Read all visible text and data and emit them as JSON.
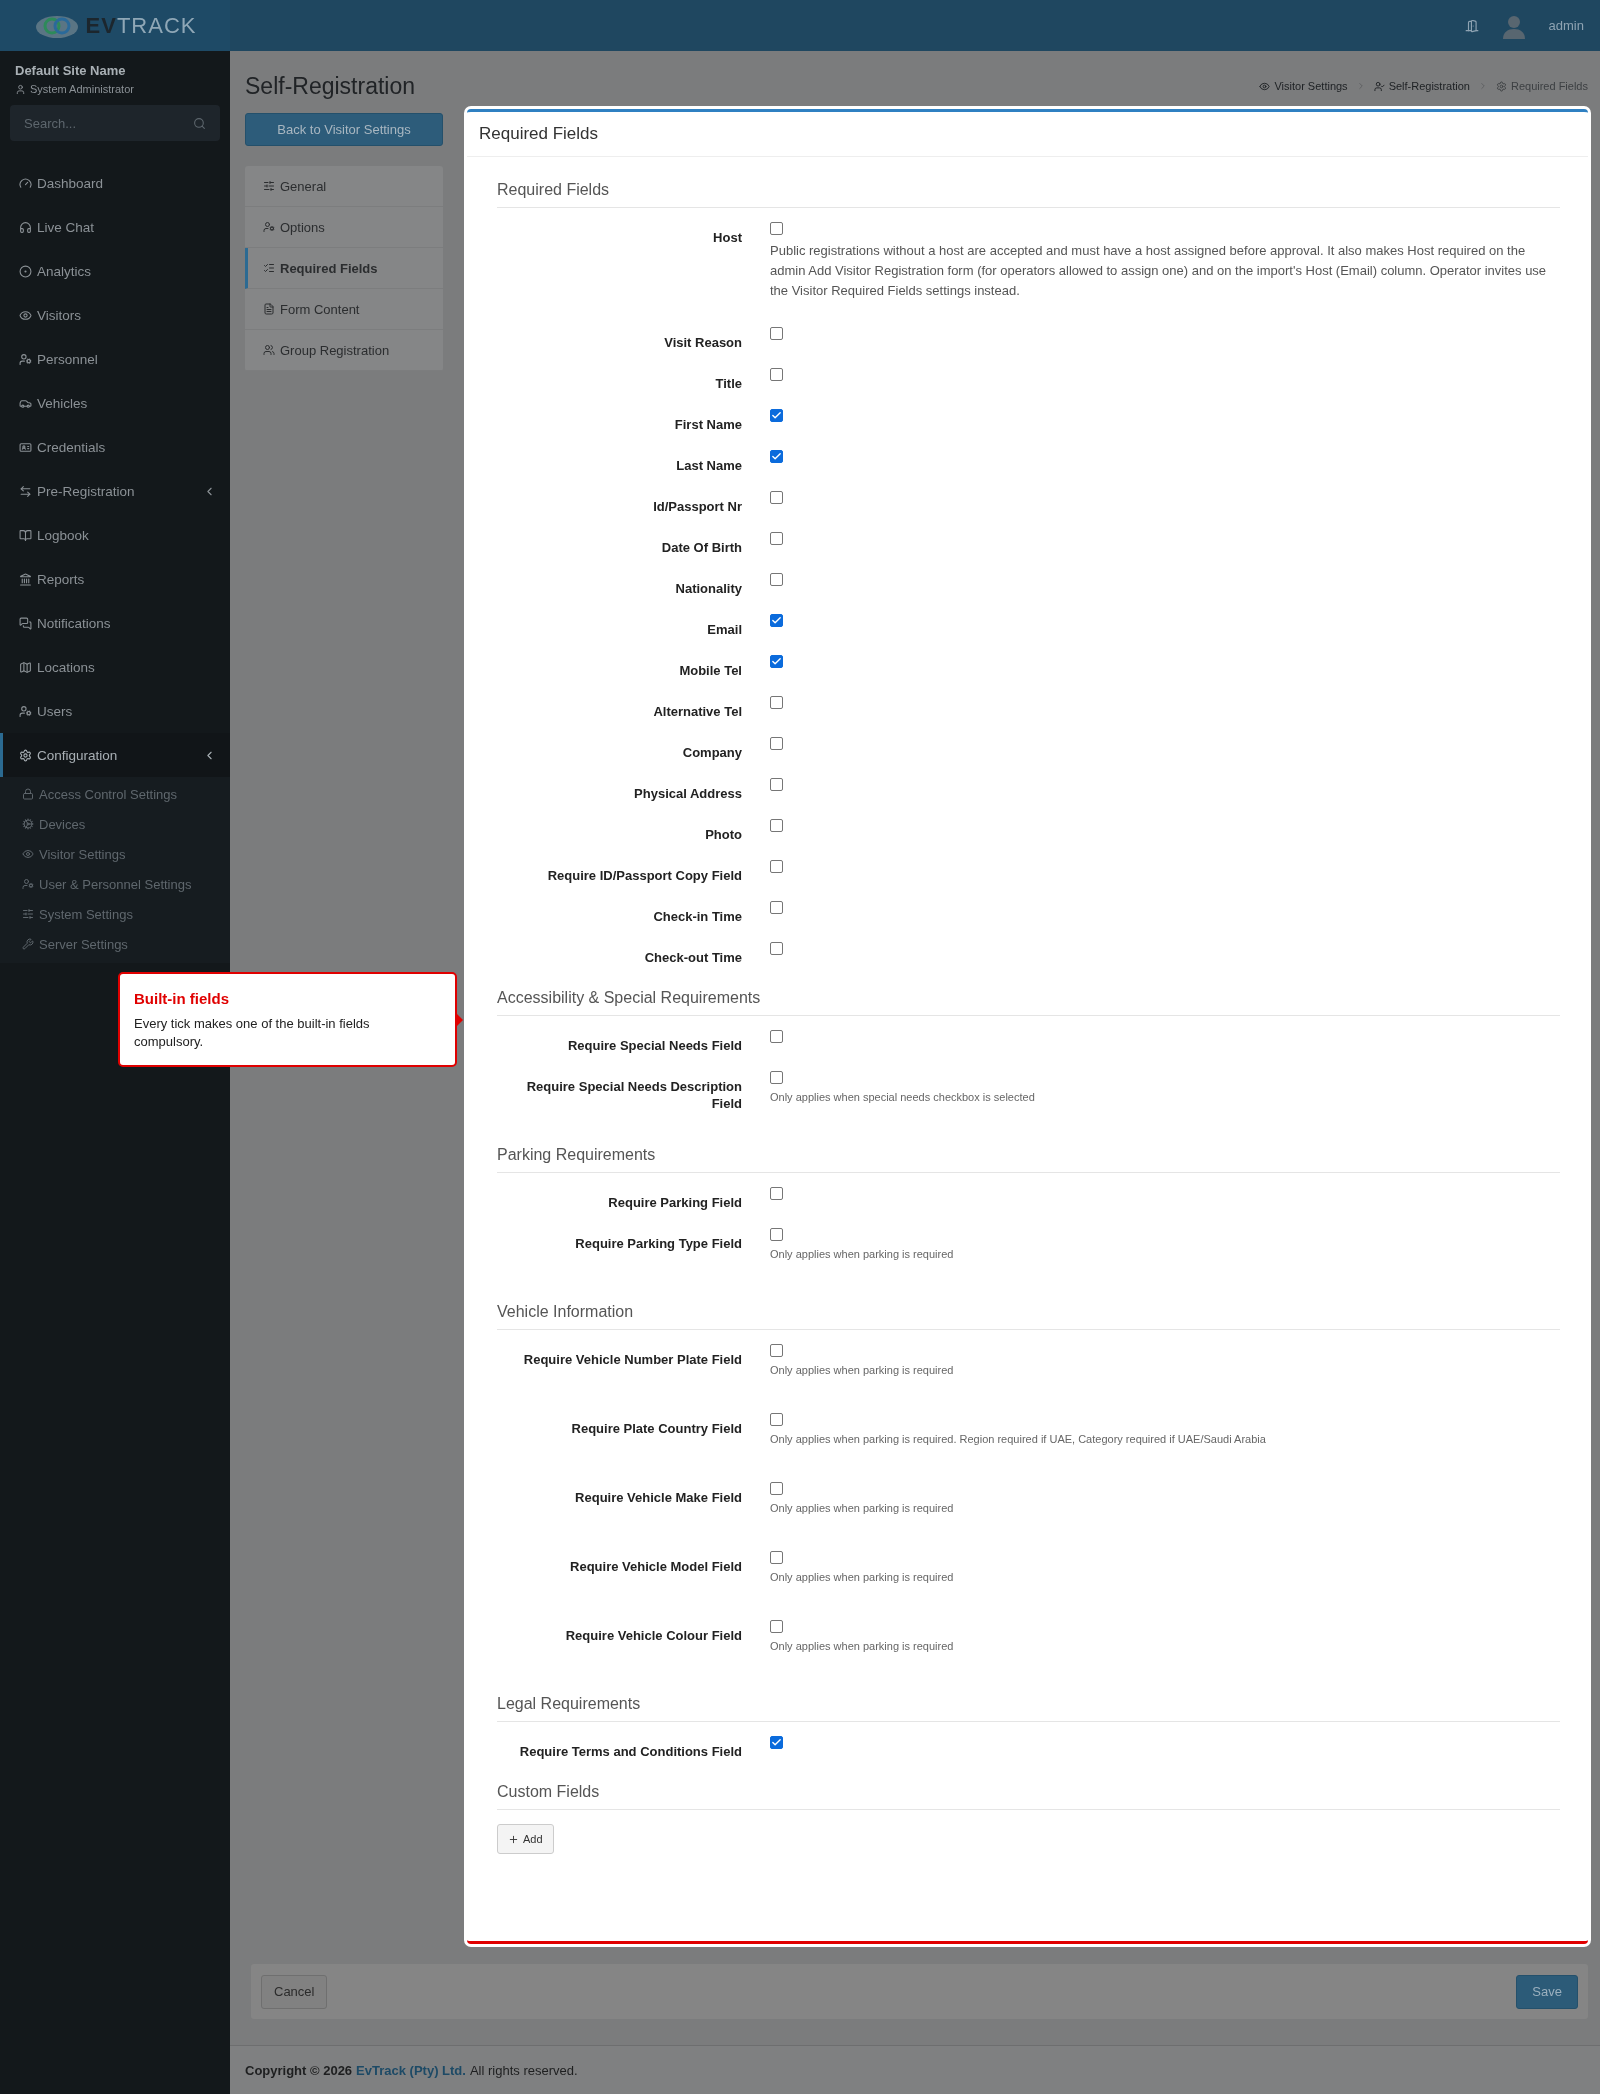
{
  "brand": {
    "logo": "**EV**TRACK"
  },
  "topbar": {
    "user": "admin"
  },
  "sidebar": {
    "site_name": "Default Site Name",
    "role": "System Administrator",
    "search": {
      "placeholder": "Search..."
    },
    "items": [
      {
        "label": "Dashboard",
        "expandable": false,
        "selected": false
      },
      {
        "label": "Live Chat",
        "expandable": false,
        "selected": false
      },
      {
        "label": "Analytics",
        "expandable": false,
        "selected": false
      },
      {
        "label": "Visitors",
        "expandable": false,
        "selected": false
      },
      {
        "label": "Personnel",
        "expandable": false,
        "selected": false
      },
      {
        "label": "Vehicles",
        "expandable": false,
        "selected": false
      },
      {
        "label": "Credentials",
        "expandable": false,
        "selected": false
      },
      {
        "label": "Pre-Registration",
        "expandable": true,
        "selected": false
      },
      {
        "label": "Logbook",
        "expandable": false,
        "selected": false
      },
      {
        "label": "Reports",
        "expandable": false,
        "selected": false
      },
      {
        "label": "Notifications",
        "expandable": false,
        "selected": false
      },
      {
        "label": "Locations",
        "expandable": false,
        "selected": false
      },
      {
        "label": "Users",
        "expandable": false,
        "selected": false
      },
      {
        "label": "Configuration",
        "expandable": true,
        "selected": true,
        "children": [
          {
            "label": "Access Control Settings"
          },
          {
            "label": "Devices"
          },
          {
            "label": "Visitor Settings"
          },
          {
            "label": "User & Personnel Settings"
          },
          {
            "label": "System Settings"
          },
          {
            "label": "Server Settings"
          }
        ]
      }
    ]
  },
  "page_title": "Self-Registration",
  "breadcrumbs": [
    {
      "label": "Visitor Settings",
      "current": false
    },
    {
      "label": "Self-Registration",
      "current": false
    },
    {
      "label": "Required Fields",
      "current": true
    }
  ],
  "back_button": "Back to Visitor Settings",
  "submenu": [
    {
      "label": "General",
      "selected": false
    },
    {
      "label": "Options",
      "selected": false
    },
    {
      "label": "Required Fields",
      "selected": true
    },
    {
      "label": "Form Content",
      "selected": false
    },
    {
      "label": "Group Registration",
      "selected": false
    }
  ],
  "card": {
    "title": "Required Fields",
    "sections": [
      {
        "title": "Required Fields",
        "fields": [
          {
            "label": "Host",
            "checked": false,
            "help": "Public registrations without a host are accepted and must have a host assigned before approval. It also makes Host required on the admin Add Visitor Registration form (for operators allowed to assign one) and on the import's Host (Email) column. Operator invites use the Visitor Required Fields settings instead."
          },
          {
            "label": "Visit Reason",
            "checked": false
          },
          {
            "label": "Title",
            "checked": false
          },
          {
            "label": "First Name",
            "checked": true
          },
          {
            "label": "Last Name",
            "checked": true
          },
          {
            "label": "Id/Passport Nr",
            "checked": false
          },
          {
            "label": "Date Of Birth",
            "checked": false
          },
          {
            "label": "Nationality",
            "checked": false
          },
          {
            "label": "Email",
            "checked": true
          },
          {
            "label": "Mobile Tel",
            "checked": true
          },
          {
            "label": "Alternative Tel",
            "checked": false
          },
          {
            "label": "Company",
            "checked": false
          },
          {
            "label": "Physical Address",
            "checked": false
          },
          {
            "label": "Photo",
            "checked": false
          },
          {
            "label": "Require ID/Passport Copy Field",
            "checked": false
          },
          {
            "label": "Check-in Time",
            "checked": false
          },
          {
            "label": "Check-out Time",
            "checked": false
          }
        ]
      },
      {
        "title": "Accessibility & Special Requirements",
        "fields": [
          {
            "label": "Require Special Needs Field",
            "checked": false
          },
          {
            "label": "Require Special Needs Description Field",
            "checked": false,
            "help": "Only applies when special needs checkbox is selected"
          }
        ]
      },
      {
        "title": "Parking Requirements",
        "fields": [
          {
            "label": "Require Parking Field",
            "checked": false
          },
          {
            "label": "Require Parking Type Field",
            "checked": false,
            "help": "Only applies when parking is required"
          }
        ]
      },
      {
        "title": "Vehicle Information",
        "fields": [
          {
            "label": "Require Vehicle Number Plate Field",
            "checked": false,
            "help": "Only applies when parking is required"
          },
          {
            "label": "Require Plate Country Field",
            "checked": false,
            "help": "Only applies when parking is required. Region required if UAE, Category required if UAE/Saudi Arabia"
          },
          {
            "label": "Require Vehicle Make Field",
            "checked": false,
            "help": "Only applies when parking is required"
          },
          {
            "label": "Require Vehicle Model Field",
            "checked": false,
            "help": "Only applies when parking is required"
          },
          {
            "label": "Require Vehicle Colour Field",
            "checked": false,
            "help": "Only applies when parking is required"
          }
        ]
      },
      {
        "title": "Legal Requirements",
        "fields": [
          {
            "label": "Require Terms and Conditions Field",
            "checked": true
          }
        ]
      },
      {
        "title": "Custom Fields"
      }
    ],
    "add_button": "Add"
  },
  "actions": {
    "cancel": "Cancel",
    "save": "Save"
  },
  "footer": {
    "copyright": "Copyright © 2026",
    "company": "EvTrack (Pty) Ltd.",
    "rights": "All rights reserved."
  },
  "tour_tip": {
    "title": "Built-in fields",
    "text": "Every tick makes one of the built-in fields compulsory."
  }
}
